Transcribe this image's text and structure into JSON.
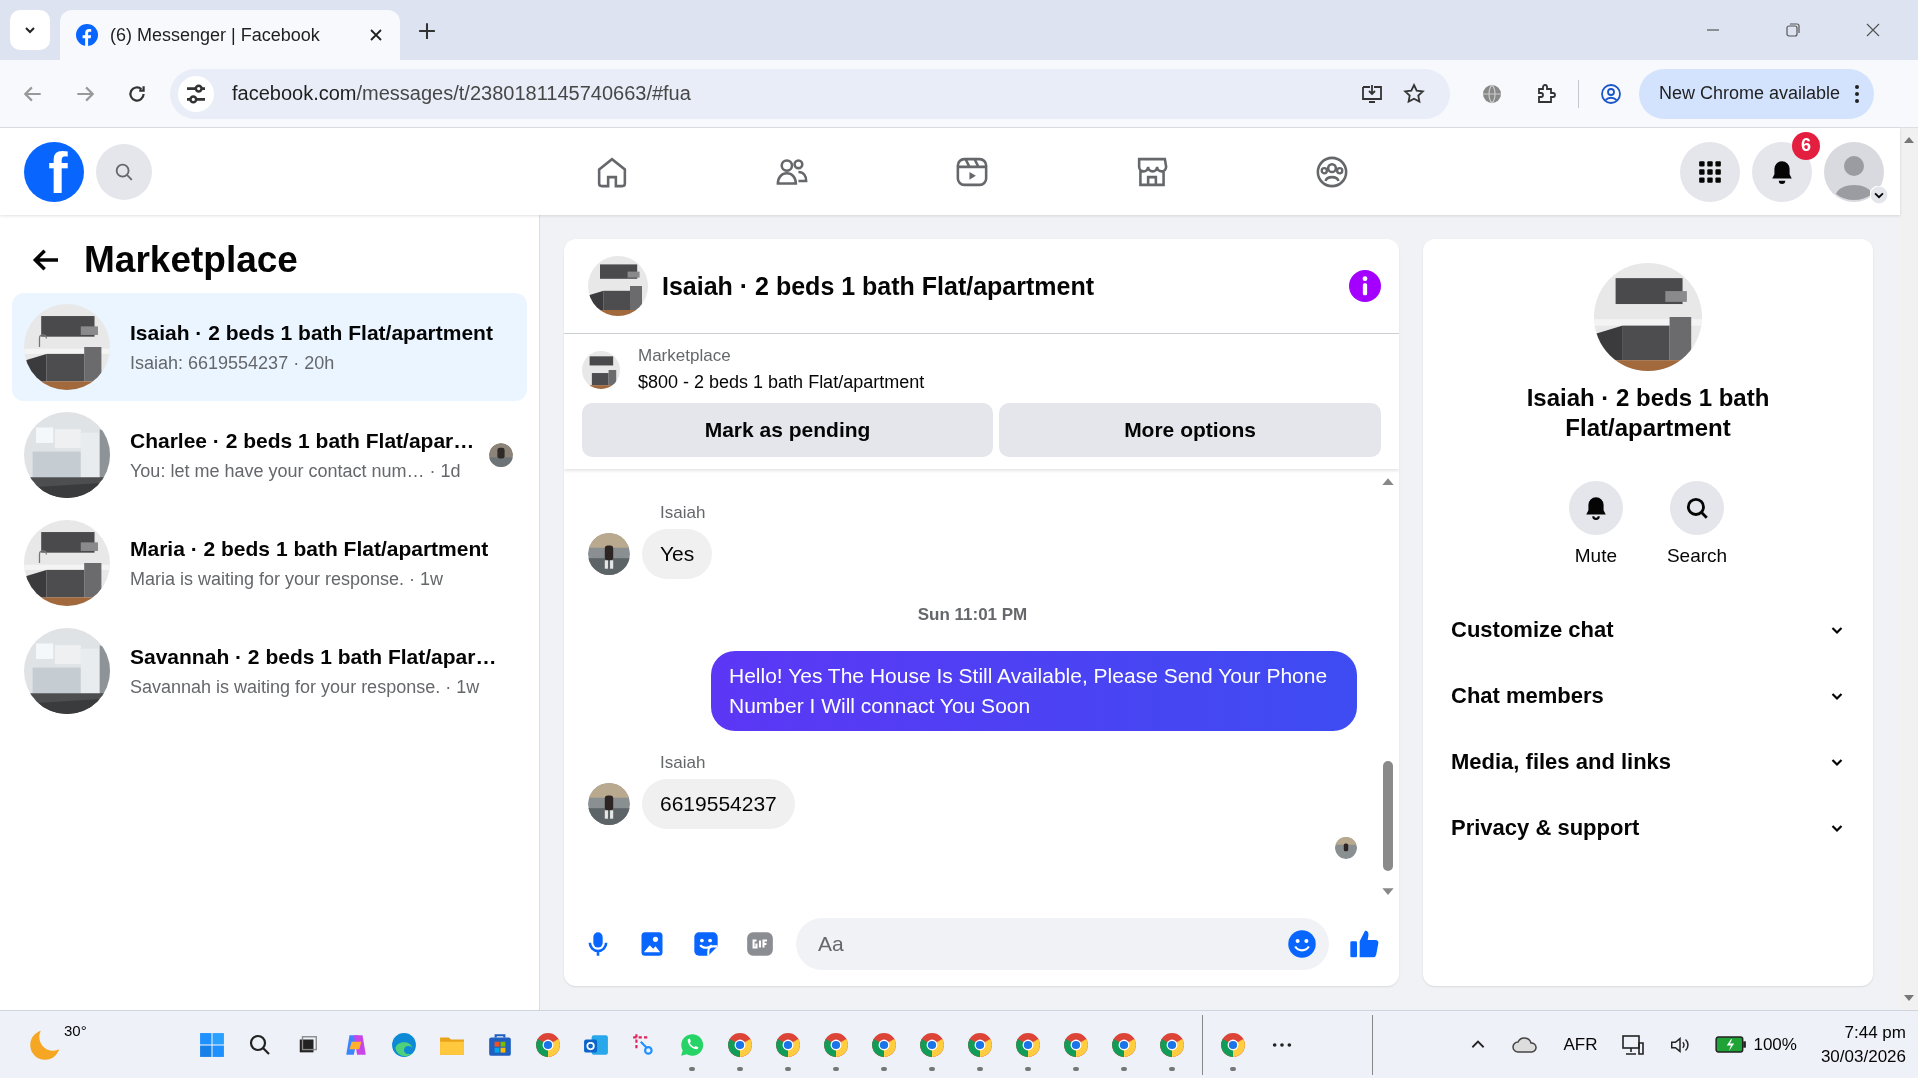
{
  "browser": {
    "tab_title": "(6) Messenger | Facebook",
    "url_host": "facebook.com",
    "url_path": "/messages/t/2380181145740663/#fua",
    "update_button": "New Chrome available"
  },
  "top_nav": {
    "logo": "f",
    "notification_count": "6"
  },
  "sidebar": {
    "title": "Marketplace",
    "conversations": [
      {
        "name": "Isaiah · 2 beds 1 bath Flat/apartment",
        "preview": "Isaiah: 6619554237 · 20h",
        "selected": true,
        "read_receipt": false
      },
      {
        "name": "Charlee · 2 beds 1 bath Flat/apar…",
        "preview": "You: let me have your contact num… · 1d",
        "selected": false,
        "read_receipt": true
      },
      {
        "name": "Maria · 2 beds 1 bath Flat/apartment",
        "preview": "Maria is waiting for your response. · 1w",
        "selected": false,
        "read_receipt": false
      },
      {
        "name": "Savannah · 2 beds 1 bath Flat/apar…",
        "preview": "Savannah is waiting for your response. · 1w",
        "selected": false,
        "read_receipt": false
      }
    ]
  },
  "chat": {
    "title": "Isaiah · 2 beds 1 bath Flat/apartment",
    "listing": {
      "label": "Marketplace",
      "title": "$800 - 2 beds 1 bath Flat/apartment"
    },
    "buttons": [
      "Mark as pending",
      "More options"
    ],
    "messages": [
      {
        "kind": "incoming",
        "sender": "Isaiah",
        "text": "Yes"
      },
      {
        "kind": "timestamp",
        "text": "Sun 11:01 PM"
      },
      {
        "kind": "outgoing",
        "text": "Hello! Yes The House  Is Still Available, Please Send Your Phone Number I Will connact You Soon"
      },
      {
        "kind": "incoming",
        "sender": "Isaiah",
        "text": "6619554237"
      }
    ],
    "composer": {
      "placeholder": "Aa"
    }
  },
  "info_panel": {
    "name": "Isaiah · 2 beds 1 bath Flat/apartment",
    "actions": [
      {
        "kind": "bell",
        "label": "Mute"
      },
      {
        "kind": "search",
        "label": "Search"
      }
    ],
    "sections": [
      {
        "label": "Customize chat",
        "expanded": false
      },
      {
        "label": "Chat members",
        "expanded": false
      },
      {
        "label": "Media, files and links",
        "expanded": false
      },
      {
        "label": "Privacy & support",
        "expanded": false
      }
    ]
  },
  "taskbar": {
    "weather": "30°",
    "language": "AFR",
    "battery": "100%",
    "time": "7:44 pm",
    "date": "30/03/2026"
  }
}
